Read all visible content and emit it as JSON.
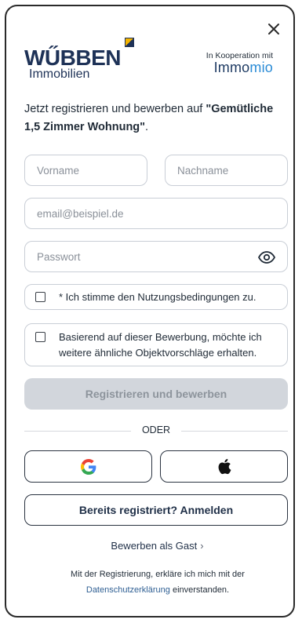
{
  "brand": {
    "name": "WŰBBEN",
    "sub": "Immobilien",
    "coop_label": "In Kooperation mit",
    "partner_part1": "Immo",
    "partner_part2": "mio"
  },
  "intro": {
    "prefix": "Jetzt registrieren und bewerben auf ",
    "listing": "\"Gemütliche 1,5 Zimmer Wohnung\"",
    "suffix": "."
  },
  "form": {
    "first_name_placeholder": "Vorname",
    "last_name_placeholder": "Nachname",
    "email_placeholder": "email@beispiel.de",
    "password_placeholder": "Passwort",
    "terms_label": "* Ich stimme den Nutzungsbedingungen zu.",
    "suggestions_label": "Basierend auf dieser Bewerbung, möchte ich weitere ähnliche Objektvorschläge erhalten.",
    "submit_label": "Registrieren und bewerben"
  },
  "divider_text": "ODER",
  "login_label": "Bereits registriert?  Anmelden",
  "guest_label": "Bewerben als Gast",
  "legal": {
    "line1": "Mit der Registrierung, erkläre ich mich mit der",
    "link": "Datenschutzerklärung",
    "line2_suffix": " einverstanden."
  },
  "icons": {
    "close": "close-icon",
    "eye": "eye-icon",
    "google": "google-icon",
    "apple": "apple-icon",
    "chevron": "chevron-right-icon"
  },
  "colors": {
    "brand_navy": "#1e3257",
    "accent_blue": "#2a8bd6",
    "disabled_button": "#d2d6dc"
  }
}
